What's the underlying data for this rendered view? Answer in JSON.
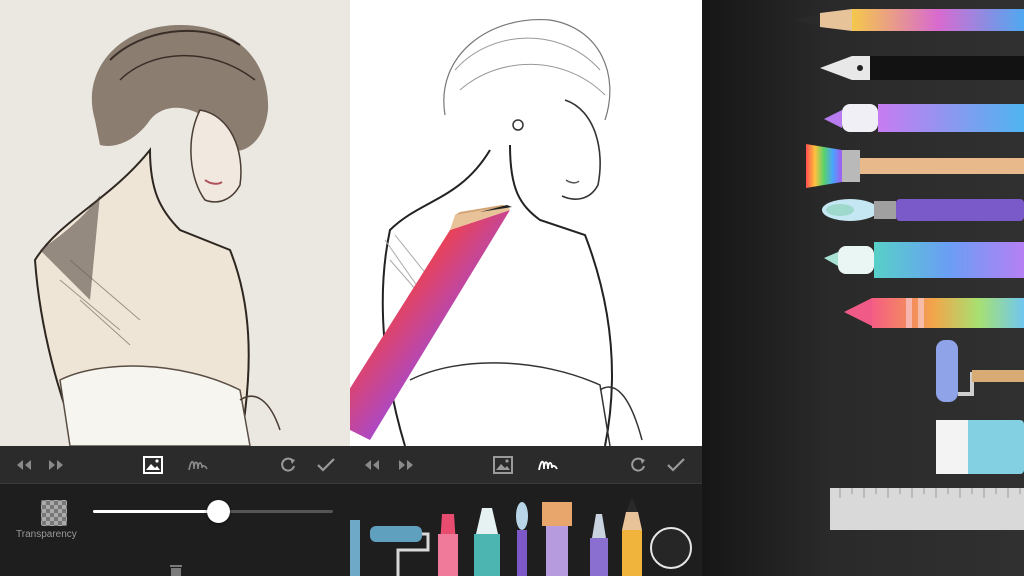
{
  "left_panel": {
    "transparency_label": "Transparency",
    "transparency_value": 0.52
  },
  "toolbar_icons": [
    "undo-icon",
    "redo-icon",
    "image-layer-icon",
    "brush-stroke-icon",
    "refresh-icon",
    "check-icon"
  ],
  "right_panel": {
    "tools": [
      "colored-pencil",
      "fountain-pen",
      "marker",
      "wide-brush",
      "round-brush",
      "felt-pen",
      "crayon",
      "paint-roller",
      "eraser",
      "ruler"
    ]
  },
  "colors": {
    "accent_white": "#ffffff",
    "toolbar_bg": "#2b2b2b",
    "panel_dark": "#1e1e1e"
  }
}
